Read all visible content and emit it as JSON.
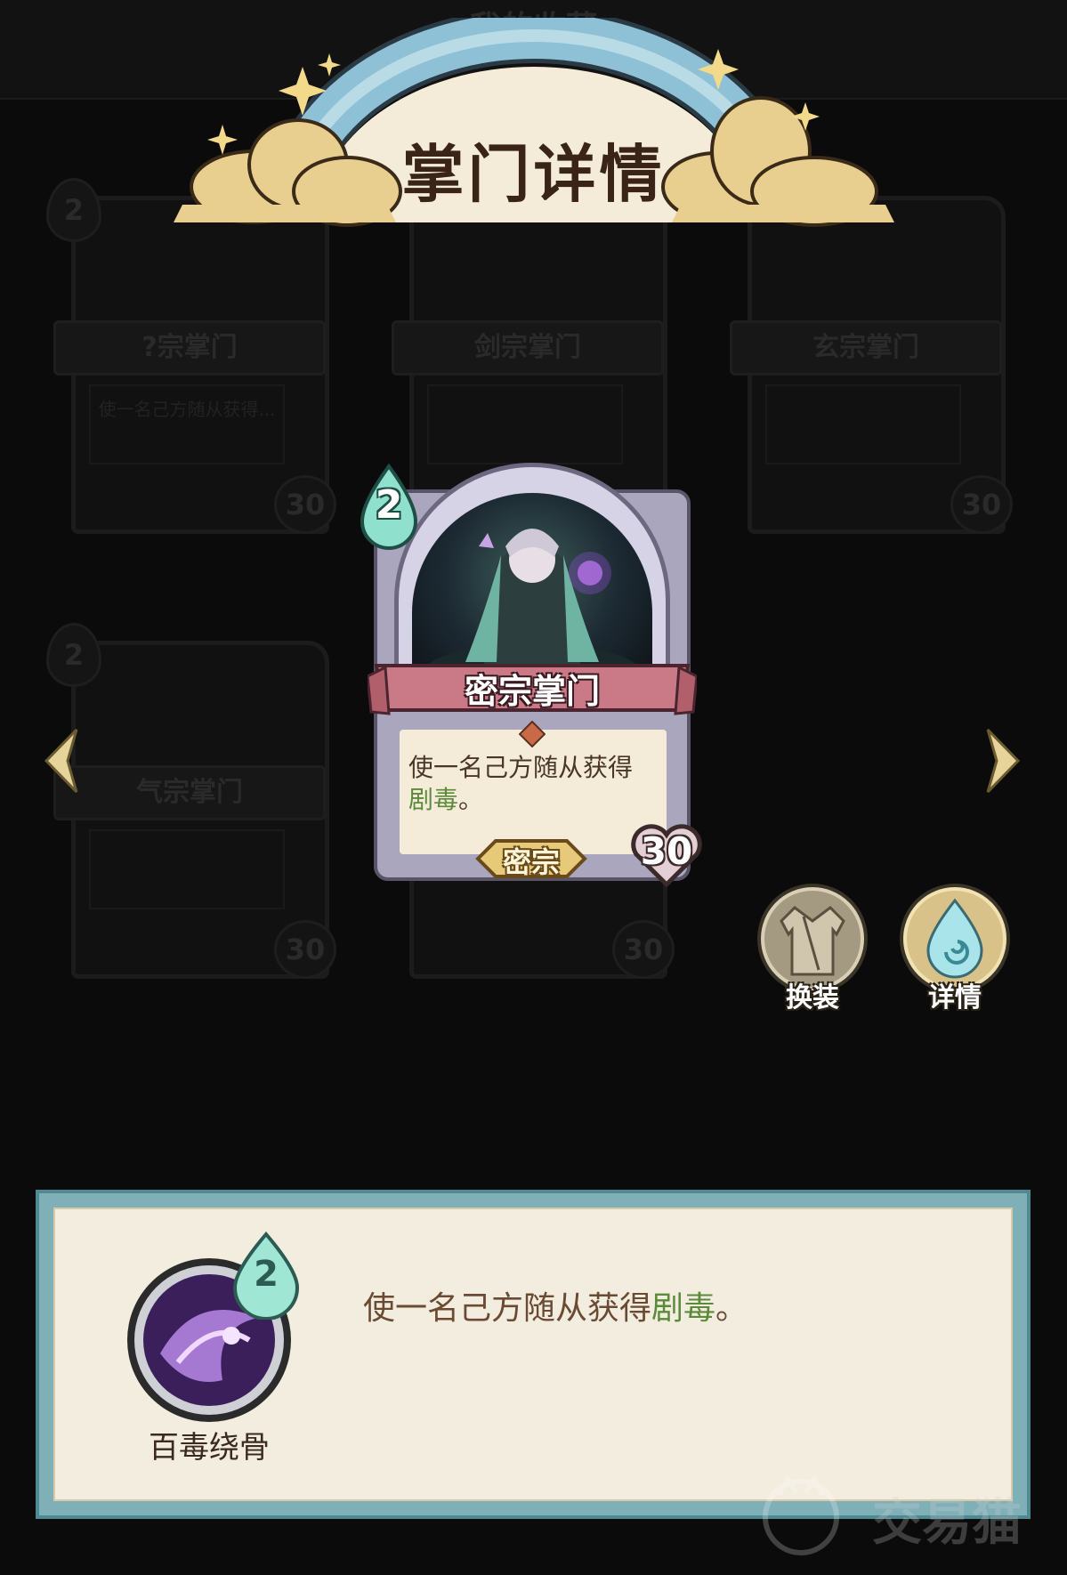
{
  "header": {
    "title_faded": "我的收藏"
  },
  "page_title": "掌门详情",
  "background_cards": [
    {
      "cost": "2",
      "name": "?宗掌门",
      "desc": "使一名己方随从获得...",
      "hp": "30"
    },
    {
      "cost": "",
      "name": "剑宗掌门",
      "desc": "",
      "hp": ""
    },
    {
      "cost": "",
      "name": "玄宗掌门",
      "desc": "",
      "hp": "30"
    },
    {
      "cost": "2",
      "name": "气宗掌门",
      "desc": "",
      "hp": "30"
    },
    {
      "cost": "",
      "name": "",
      "desc": "",
      "hp": "30"
    }
  ],
  "card": {
    "cost": "2",
    "name": "密宗掌门",
    "desc_prefix": "使一名己方随从获得",
    "desc_keyword": "剧毒",
    "desc_suffix": "。",
    "sect_tag": "密宗",
    "hp": "30"
  },
  "actions": {
    "change_outfit": "换装",
    "details": "详情"
  },
  "skill": {
    "cost": "2",
    "name": "百毒绕骨",
    "desc_prefix": "使一名己方随从获得",
    "desc_keyword": "剧毒",
    "desc_suffix": "。"
  },
  "watermark": "交易猫",
  "colors": {
    "keyword_green": "#5b8a3a",
    "panel_border": "#7fb0b8"
  }
}
